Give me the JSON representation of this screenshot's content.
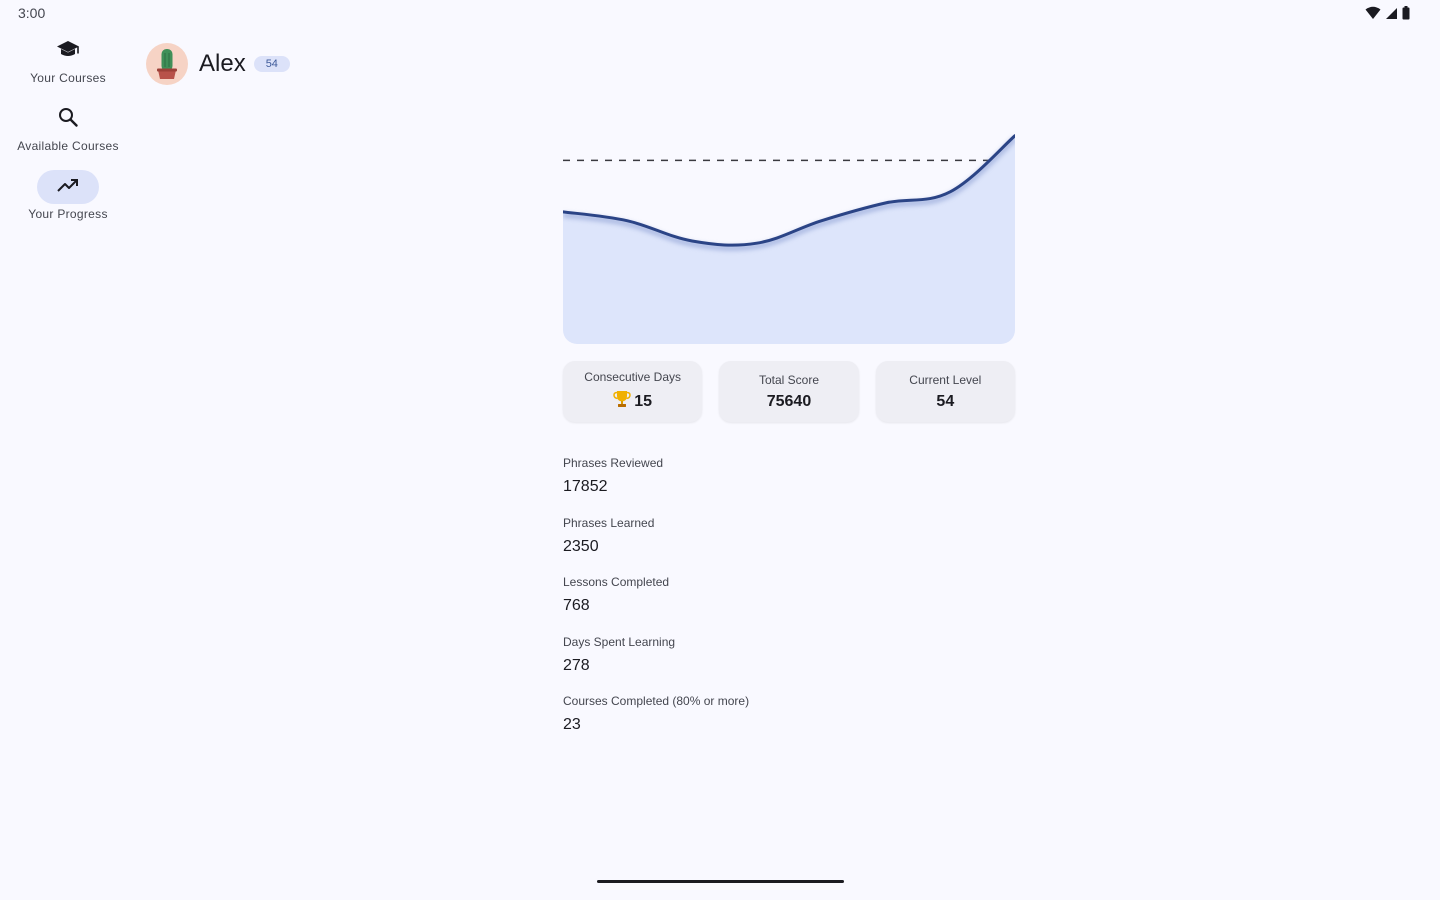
{
  "status_bar": {
    "time": "3:00",
    "icons": [
      "wifi-icon",
      "cell-signal-icon",
      "battery-icon"
    ]
  },
  "nav_rail": {
    "items": [
      {
        "label": "Your Courses",
        "icon": "school-icon",
        "active": false
      },
      {
        "label": "Available Courses",
        "icon": "search-icon",
        "active": false
      },
      {
        "label": "Your Progress",
        "icon": "trending-up-icon",
        "active": true
      }
    ]
  },
  "header": {
    "user_name": "Alex",
    "level_badge": "54",
    "avatar_icon": "cactus-avatar-icon"
  },
  "chart_data": {
    "type": "area",
    "title": "",
    "xlabel": "",
    "ylabel": "",
    "x": [
      0,
      1,
      2,
      3,
      4,
      5,
      6,
      7
    ],
    "series": [
      {
        "values": [
          0.59,
          0.55,
          0.46,
          0.45,
          0.55,
          0.63,
          0.68,
          0.93
        ]
      }
    ],
    "reference_line": 0.82,
    "ylim": [
      0,
      1
    ],
    "grid": false,
    "colors": {
      "line": "#2b4486",
      "fill": "#dde5fb"
    }
  },
  "stat_cards": [
    {
      "title": "Consecutive Days",
      "value": "15",
      "icon": "trophy-icon"
    },
    {
      "title": "Total Score",
      "value": "75640"
    },
    {
      "title": "Current Level",
      "value": "54"
    }
  ],
  "metrics": [
    {
      "label": "Phrases Reviewed",
      "value": "17852"
    },
    {
      "label": "Phrases Learned",
      "value": "2350"
    },
    {
      "label": "Lessons Completed",
      "value": "768"
    },
    {
      "label": "Days Spent Learning",
      "value": "278"
    },
    {
      "label": "Courses Completed (80% or more)",
      "value": "23"
    }
  ],
  "colors": {
    "background": "#f9f9ff",
    "accent_container": "#dce2f9",
    "card": "#eeeef4",
    "trophy": "#f0b000"
  }
}
